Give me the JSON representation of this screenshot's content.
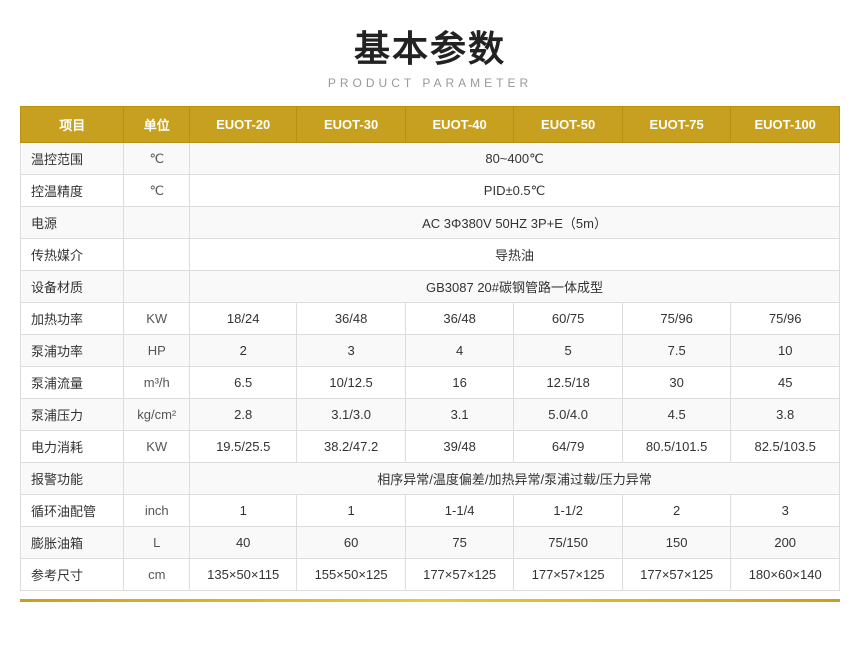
{
  "title": "基本参数",
  "subtitle": "PRODUCT PARAMETER",
  "table": {
    "headers": [
      "项目",
      "单位",
      "EUOT-20",
      "EUOT-30",
      "EUOT-40",
      "EUOT-50",
      "EUOT-75",
      "EUOT-100"
    ],
    "rows": [
      {
        "label": "温控范围",
        "unit": "℃",
        "values": [
          "80~400℃",
          "",
          "",
          "",
          "",
          ""
        ],
        "colspan": true,
        "colspanValue": "80~400℃"
      },
      {
        "label": "控温精度",
        "unit": "℃",
        "values": [
          "PID±0.5℃",
          "",
          "",
          "",
          "",
          ""
        ],
        "colspan": true,
        "colspanValue": "PID±0.5℃"
      },
      {
        "label": "电源",
        "unit": "",
        "values": [
          "AC 3Φ380V 50HZ 3P+E（5m）",
          "",
          "",
          "",
          "",
          ""
        ],
        "colspan": true,
        "colspanValue": "AC 3Φ380V 50HZ 3P+E（5m）"
      },
      {
        "label": "传热媒介",
        "unit": "",
        "values": [
          "导热油",
          "",
          "",
          "",
          "",
          ""
        ],
        "colspan": true,
        "colspanValue": "导热油"
      },
      {
        "label": "设备材质",
        "unit": "",
        "values": [
          "GB3087   20#碳钢管路一体成型",
          "",
          "",
          "",
          "",
          ""
        ],
        "colspan": true,
        "colspanValue": "GB3087   20#碳钢管路一体成型"
      },
      {
        "label": "加热功率",
        "unit": "KW",
        "values": [
          "18/24",
          "36/48",
          "36/48",
          "60/75",
          "75/96",
          "75/96"
        ],
        "colspan": false
      },
      {
        "label": "泵浦功率",
        "unit": "HP",
        "values": [
          "2",
          "3",
          "4",
          "5",
          "7.5",
          "10"
        ],
        "colspan": false
      },
      {
        "label": "泵浦流量",
        "unit": "m³/h",
        "values": [
          "6.5",
          "10/12.5",
          "16",
          "12.5/18",
          "30",
          "45"
        ],
        "colspan": false
      },
      {
        "label": "泵浦压力",
        "unit": "kg/cm²",
        "values": [
          "2.8",
          "3.1/3.0",
          "3.1",
          "5.0/4.0",
          "4.5",
          "3.8"
        ],
        "colspan": false
      },
      {
        "label": "电力消耗",
        "unit": "KW",
        "values": [
          "19.5/25.5",
          "38.2/47.2",
          "39/48",
          "64/79",
          "80.5/101.5",
          "82.5/103.5"
        ],
        "colspan": false
      },
      {
        "label": "报警功能",
        "unit": "",
        "values": [
          "相序异常/温度偏差/加热异常/泵浦过载/压力异常",
          "",
          "",
          "",
          "",
          ""
        ],
        "colspan": true,
        "colspanValue": "相序异常/温度偏差/加热异常/泵浦过载/压力异常"
      },
      {
        "label": "循环油配管",
        "unit": "inch",
        "values": [
          "1",
          "1",
          "1-1/4",
          "1-1/2",
          "2",
          "3"
        ],
        "colspan": false
      },
      {
        "label": "膨胀油箱",
        "unit": "L",
        "values": [
          "40",
          "60",
          "75",
          "75/150",
          "150",
          "200"
        ],
        "colspan": false
      },
      {
        "label": "参考尺寸",
        "unit": "cm",
        "values": [
          "135×50×115",
          "155×50×125",
          "177×57×125",
          "177×57×125",
          "177×57×125",
          "180×60×140"
        ],
        "colspan": false
      }
    ]
  }
}
